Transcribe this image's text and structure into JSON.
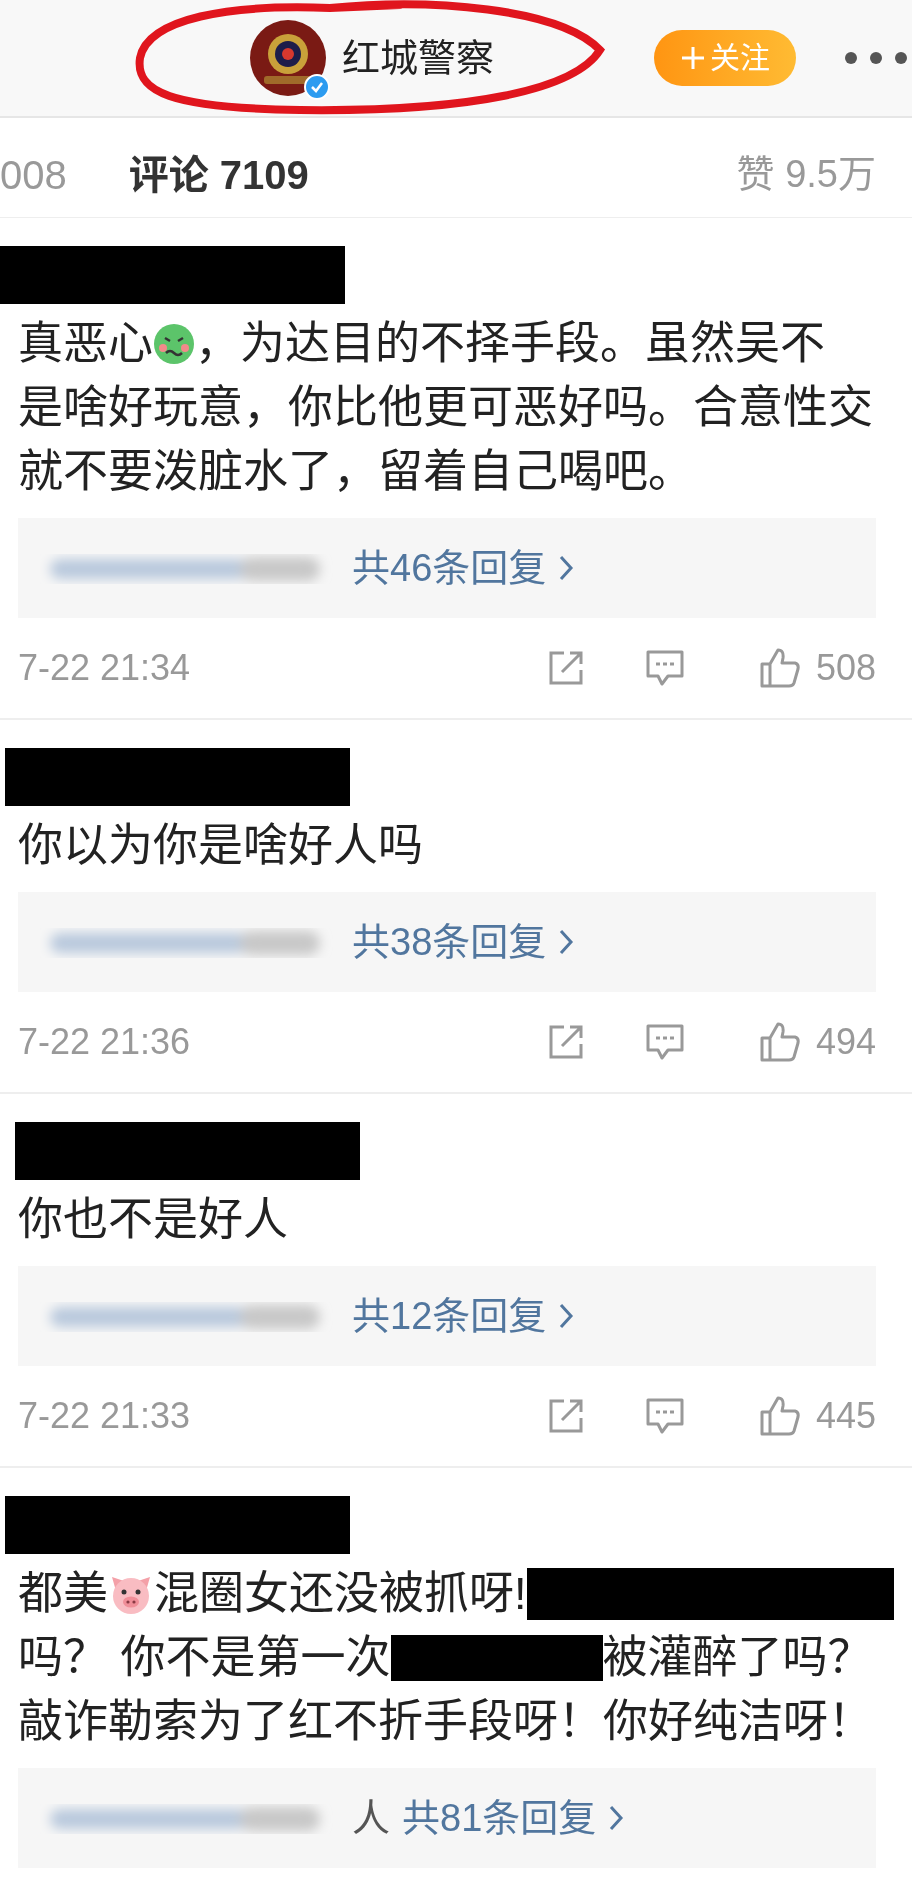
{
  "header": {
    "account_name": "红城警察",
    "verified": true,
    "follow_button": "关注"
  },
  "tabs": [
    {
      "label": "008",
      "selected": false
    },
    {
      "label": "评论 7109",
      "selected": true
    }
  ],
  "likes_summary": "赞 9.5万",
  "comments": [
    {
      "lines": [
        [
          {
            "kind": "text",
            "text": "真恶心"
          },
          {
            "kind": "sick"
          },
          {
            "kind": "text",
            "text": "，为达目的不择手段。虽然吴不"
          }
        ],
        [
          {
            "kind": "text",
            "text": "是啥好玩意，你比他更可恶好吗。合意性交"
          }
        ],
        [
          {
            "kind": "text",
            "text": "就不要泼脏水了，留着自己喝吧。"
          }
        ]
      ],
      "replies": {
        "count": "共46条回复"
      },
      "time": "7-22 21:34",
      "likes": "508"
    },
    {
      "lines": [
        [
          {
            "kind": "text",
            "text": "你以为你是啥好人吗"
          }
        ]
      ],
      "replies": {
        "count": "共38条回复"
      },
      "time": "7-22 21:36",
      "likes": "494"
    },
    {
      "lines": [
        [
          {
            "kind": "text",
            "text": "你也不是好人"
          }
        ]
      ],
      "replies": {
        "count": "共12条回复"
      },
      "time": "7-22 21:33",
      "likes": "445"
    },
    {
      "lines": [
        [
          {
            "kind": "text",
            "text": "都美"
          },
          {
            "kind": "pig"
          },
          {
            "kind": "text",
            "text": "混圈女还没被抓呀!"
          },
          {
            "kind": "redaction"
          }
        ],
        [
          {
            "kind": "text",
            "text": "吗？ 你不是第一次"
          },
          {
            "kind": "redaction"
          },
          {
            "kind": "text",
            "text": "被灌醉了吗？"
          }
        ],
        [
          {
            "kind": "text",
            "text": "敲诈勒索为了红不折手段呀！你好纯洁呀！"
          }
        ]
      ],
      "replies": {
        "prefix": "人",
        "count": "共81条回复"
      }
    }
  ]
}
